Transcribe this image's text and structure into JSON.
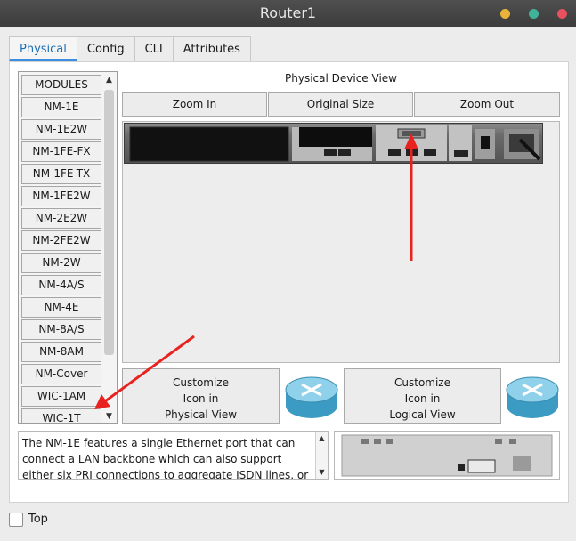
{
  "window": {
    "title": "Router1"
  },
  "tabs": [
    "Physical",
    "Config",
    "CLI",
    "Attributes"
  ],
  "modules": {
    "items": [
      "MODULES",
      "NM-1E",
      "NM-1E2W",
      "NM-1FE-FX",
      "NM-1FE-TX",
      "NM-1FE2W",
      "NM-2E2W",
      "NM-2FE2W",
      "NM-2W",
      "NM-4A/S",
      "NM-4E",
      "NM-8A/S",
      "NM-8AM",
      "NM-Cover",
      "WIC-1AM",
      "WIC-1T"
    ]
  },
  "device_view": {
    "title": "Physical Device View",
    "zoom_in": "Zoom In",
    "original_size": "Original Size",
    "zoom_out": "Zoom Out"
  },
  "customize": {
    "physical": [
      "Customize",
      "Icon in",
      "Physical View"
    ],
    "logical": [
      "Customize",
      "Icon in",
      "Logical View"
    ]
  },
  "description": "The NM-1E features a single Ethernet port that can connect a LAN backbone which can also support either six PRI connections to aggregate ISDN lines, or",
  "footer": {
    "top_label": "Top"
  },
  "colors": {
    "annotation_arrow": "#e8231f",
    "tab_accent": "#3c8ee0"
  }
}
